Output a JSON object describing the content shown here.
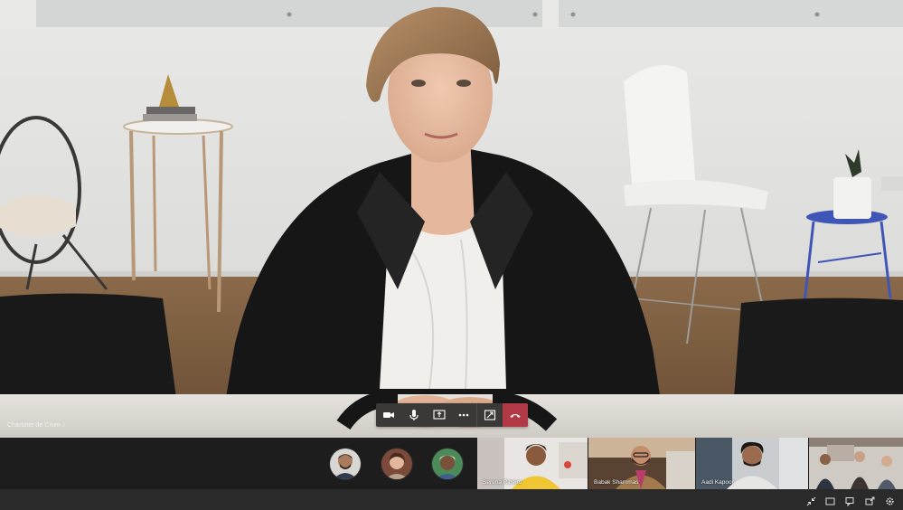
{
  "main_video": {
    "speaker_name": "Charlotte de Crum"
  },
  "call_controls": [
    {
      "id": "camera",
      "icon": "video-camera-icon"
    },
    {
      "id": "mic",
      "icon": "microphone-icon"
    },
    {
      "id": "share",
      "icon": "share-screen-icon"
    },
    {
      "id": "more",
      "icon": "more-options-icon"
    },
    {
      "id": "popout",
      "icon": "popout-icon"
    },
    {
      "id": "hangup",
      "icon": "hang-up-icon"
    }
  ],
  "participants": {
    "avatars": [
      {
        "icon": "participant-avatar-icon"
      },
      {
        "icon": "participant-avatar-icon"
      },
      {
        "icon": "participant-avatar-icon"
      }
    ],
    "video_tiles": [
      {
        "name": "Serena Ribeiro"
      },
      {
        "name": "Babak Shammas"
      },
      {
        "name": "Aadi Kapoor"
      },
      {
        "name": ""
      }
    ]
  },
  "status_bar": {
    "icons": [
      "collapse-icon",
      "fullscreen-icon",
      "chat-icon",
      "share-tray-icon",
      "settings-icon"
    ]
  },
  "colors": {
    "hangup_red": "#b23a47",
    "control_bar": "#3a3938",
    "strip_bg": "#1e1d1d",
    "status_bg": "#2b2a2a"
  }
}
